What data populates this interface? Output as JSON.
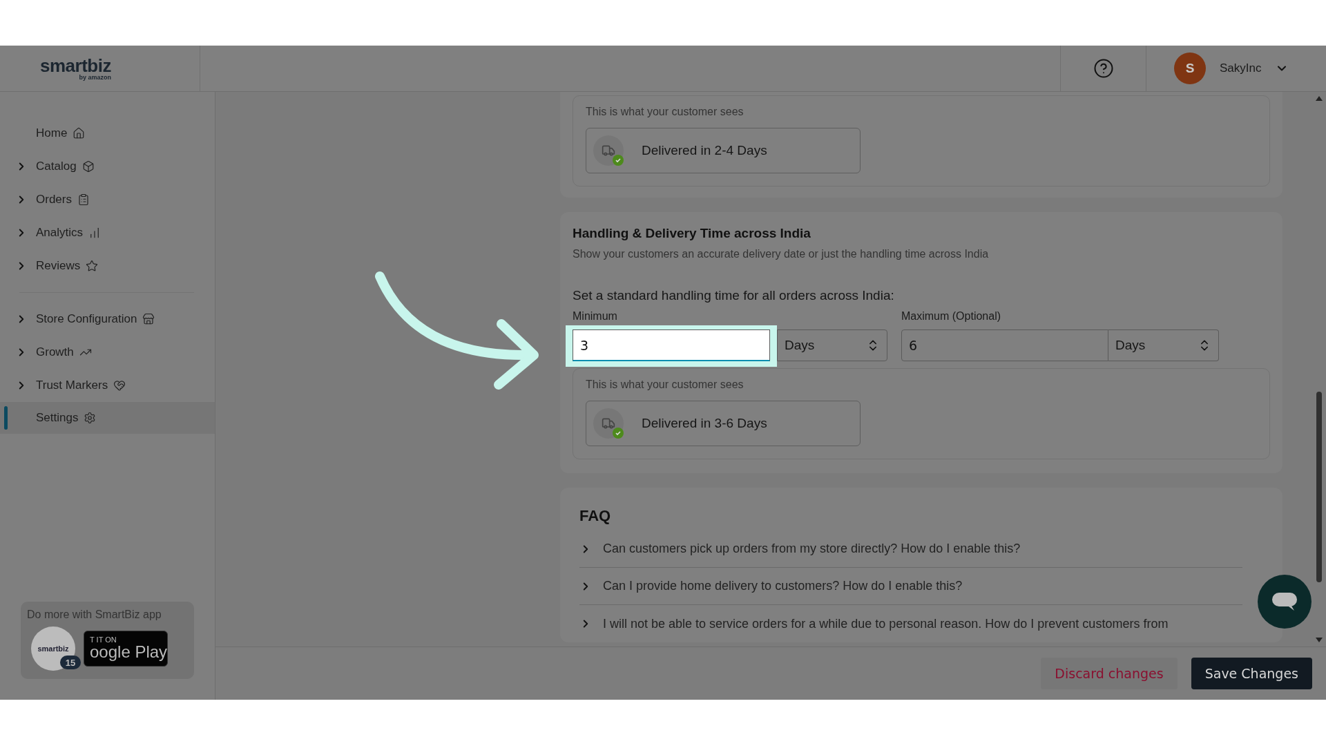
{
  "header": {
    "logo": "smartbiz",
    "logo_sub": "by amazon",
    "user": {
      "initial": "S",
      "name": "SakyInc"
    }
  },
  "sidebar": {
    "sections": [
      {
        "items": [
          {
            "label": "Home",
            "expandable": false,
            "selected": false
          },
          {
            "label": "Catalog",
            "expandable": true,
            "selected": false
          },
          {
            "label": "Orders",
            "expandable": true,
            "selected": false
          },
          {
            "label": "Analytics",
            "expandable": true,
            "selected": false
          },
          {
            "label": "Reviews",
            "expandable": true,
            "selected": false
          }
        ]
      },
      {
        "items": [
          {
            "label": "Store Configuration",
            "expandable": true,
            "selected": false
          },
          {
            "label": "Growth",
            "expandable": true,
            "selected": false
          },
          {
            "label": "Trust Markers",
            "expandable": true,
            "selected": false
          },
          {
            "label": "Settings",
            "expandable": false,
            "selected": true
          }
        ]
      }
    ],
    "promo": {
      "title": "Do more with SmartBiz app",
      "badge_top": "T IT ON",
      "badge_main": "oogle Play",
      "overlay_logo": "smartbiz",
      "count": "15"
    }
  },
  "preview_top": {
    "caption": "This is what your customer sees",
    "text": "Delivered in 2-4 Days"
  },
  "handling": {
    "title": "Handling & Delivery Time across India",
    "subtitle": "Show your customers an accurate delivery date or just the handling time across India",
    "prompt": "Set a standard handling time for all orders across India:",
    "fields": [
      {
        "label": "Minimum",
        "value": "3",
        "unit": "Days",
        "highlighted": true
      },
      {
        "label": "Maximum (Optional)",
        "value": "6",
        "unit": "Days",
        "highlighted": false
      }
    ],
    "preview": {
      "caption": "This is what your customer sees",
      "text": "Delivered in 3-6 Days"
    }
  },
  "faq": {
    "title": "FAQ",
    "items": [
      {
        "question": "Can customers pick up orders from my store directly? How do I enable this?",
        "expanded": false
      },
      {
        "question": "Can I provide home delivery to customers? How do I enable this?",
        "expanded": false
      },
      {
        "question": "I will not be able to service orders for a while due to personal reason. How do I prevent customers from",
        "expanded": false
      }
    ]
  },
  "footer": {
    "buttons": [
      {
        "label": "Discard changes",
        "kind": "secondary"
      },
      {
        "label": "Save Changes",
        "kind": "primary"
      }
    ]
  }
}
